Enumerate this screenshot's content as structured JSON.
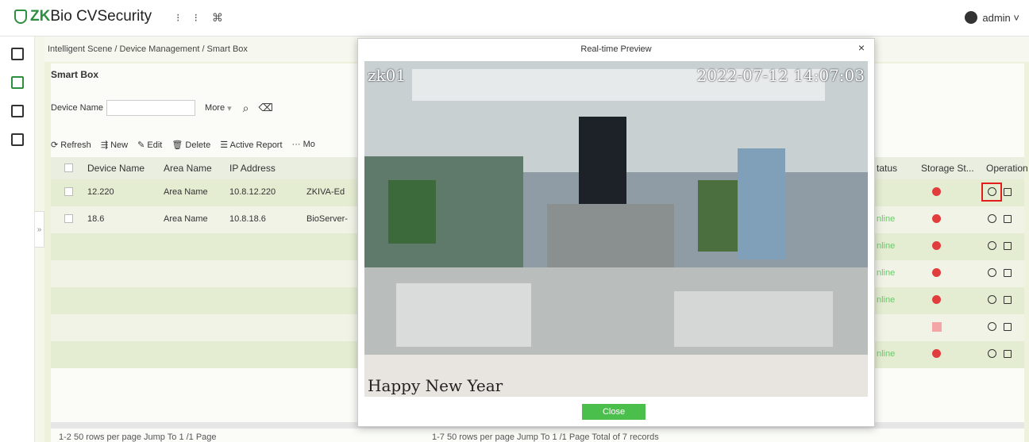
{
  "app": {
    "brand_zk": "ZK",
    "brand_rest": "Bio CVSecurity",
    "user": "admin"
  },
  "breadcrumb": "Intelligent Scene / Device Management / Smart Box",
  "page_title": "Smart Box",
  "filter": {
    "label": "Device Name",
    "more": "More"
  },
  "toolbar": [
    "Refresh",
    "New",
    "Edit",
    "Delete",
    "Active Report",
    "Mo"
  ],
  "table": {
    "left_headers": [
      "Device Name",
      "Area Name",
      "IP Address"
    ],
    "right_headers": [
      "tatus",
      "Storage St...",
      "Operation"
    ],
    "rows": [
      {
        "name": "12.220",
        "area": "Area Name",
        "ip": "10.8.12.220",
        "type": "ZKIVA-Ed"
      },
      {
        "name": "18.6",
        "area": "Area Name",
        "ip": "10.8.18.6",
        "type": "BioServer-"
      }
    ],
    "status_rows": [
      "",
      "nline",
      "nline",
      "nline",
      "nline",
      "",
      "nline"
    ]
  },
  "pager_left": "1-2    50 rows per page    Jump To 1    /1 Page",
  "pager_right": "1-7    50 rows per page    Jump To 1    /1 Page    Total of 7 records",
  "modal": {
    "title": "Real-time Preview",
    "cam": "zk01",
    "timestamp": "2022-07-12 14:07:03",
    "overlay": "Happy New Year",
    "close": "Close"
  },
  "colors": {
    "accent": "#4bbf4b",
    "brand": "#2d8f3f",
    "danger": "#e23d3d"
  }
}
